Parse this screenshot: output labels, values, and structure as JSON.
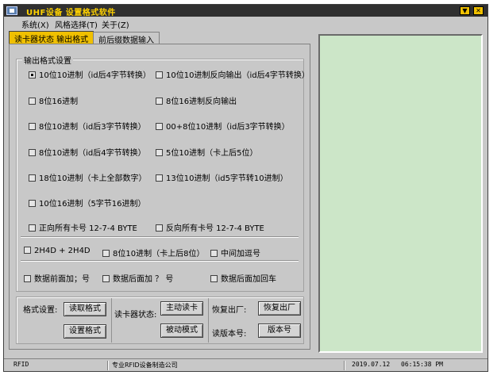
{
  "window": {
    "title": "UHF设备 设置格式软件",
    "min_btn": "▼",
    "close_btn": "✕"
  },
  "menu": [
    "系统(X)",
    "风格选择(T)",
    "关于(Z)"
  ],
  "tabs": [
    "读卡器状态 输出格式",
    "前后缀数据输入"
  ],
  "output_group": {
    "label": "输出格式设置",
    "options": [
      {
        "label": "10位10进制（id后4字节转换）",
        "checked": true
      },
      {
        "label": "10位10进制反向输出（id后4字节转换）",
        "checked": false
      },
      {
        "label": "8位16进制",
        "checked": false
      },
      {
        "label": "8位16进制反向输出",
        "checked": false
      },
      {
        "label": "8位10进制（id后3字节转换）",
        "checked": false
      },
      {
        "label": "00+8位10进制（id后3字节转换）",
        "checked": false
      },
      {
        "label": "8位10进制（id后4字节转换）",
        "checked": false
      },
      {
        "label": "5位10进制（卡上后5位）",
        "checked": false
      },
      {
        "label": "18位10进制（卡上全部数字）",
        "checked": false
      },
      {
        "label": "13位10进制（id5字节转10进制）",
        "checked": false
      },
      {
        "label": "10位16进制（5字节16进制）",
        "checked": false
      },
      {
        "label": "正向所有卡号 12-7-4 BYTE",
        "checked": false
      },
      {
        "label": "反向所有卡号 12-7-4 BYTE",
        "checked": false
      }
    ]
  },
  "extra_options": [
    {
      "label": "2H4D + 2H4D",
      "checked": false
    },
    {
      "label": "8位10进制（卡上后8位）",
      "checked": false
    },
    {
      "label": "中间加逗号",
      "checked": false
    },
    {
      "label": "数据前面加；号",
      "checked": false
    },
    {
      "label": "数据后面加 ？ 号",
      "checked": false
    },
    {
      "label": "数据后面加回车",
      "checked": false
    }
  ],
  "controls": {
    "format_label": "格式设置:",
    "read_format": "读取格式",
    "set_format": "设置格式",
    "reader_state_label": "读卡器状态:",
    "active_read": "主动读卡",
    "passive_mode": "被动模式",
    "factory_label": "恢复出厂:",
    "factory_btn": "恢复出厂",
    "version_label": "读版本号:",
    "version_btn": "版本号"
  },
  "status": {
    "left": "RFID",
    "middle": "专业RFID设备制造公司",
    "date": "2019.07.12",
    "time": "06:15:38 PM"
  },
  "colors": {
    "titlebar": "#303030",
    "title_text": "#ffd200",
    "active_tab": "#f0c000",
    "log_panel": "#cce6c8",
    "window_bg": "#c8c8c8"
  }
}
